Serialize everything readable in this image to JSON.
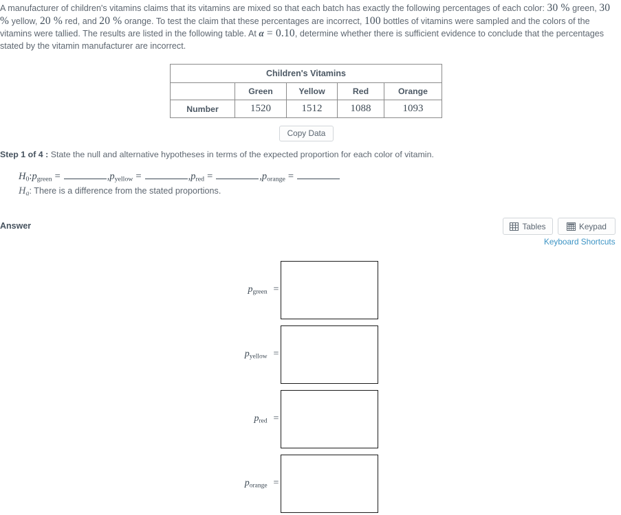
{
  "problem": {
    "part1": "A manufacturer of children's vitamins claims that its vitamins are mixed so that each batch has exactly the following percentages of each color: ",
    "pct_green": "30 %",
    "after_green": " green, ",
    "pct_yellow": "30 %",
    "after_yellow": " yellow, ",
    "pct_red": "20 %",
    "after_red": " red, and ",
    "pct_orange": "20 %",
    "after_orange": " orange. To test the claim that these percentages are incorrect, ",
    "sample_size": "100",
    "part2": " bottles of vitamins were sampled and the colors of the vitamins were tallied. The results are listed in the following table. At ",
    "alpha_symbol": "α",
    "equals": " = ",
    "alpha_value": "0.10",
    "part3": ", determine whether there is sufficient evidence to conclude that the percentages stated by the vitamin manufacturer are incorrect."
  },
  "data_table": {
    "title": "Children's Vitamins",
    "row_header_blank": "",
    "columns": [
      "Green",
      "Yellow",
      "Red",
      "Orange"
    ],
    "row_label": "Number",
    "values": [
      "1520",
      "1512",
      "1088",
      "1093"
    ]
  },
  "copy_data_button": {
    "label": "Copy Data"
  },
  "step": {
    "label": "Step 1 of 4 :",
    "text": "State the null and alternative hypotheses in terms of the expected proportion for each color of vitamin."
  },
  "hypotheses": {
    "h0_symbol": "H",
    "h0_sub": "0",
    "h0_colon": ":",
    "p_symbol": "p",
    "sub_green": "green",
    "sub_yellow": "yellow",
    "sub_red": "red",
    "sub_orange": "orange",
    "equals": "=",
    "comma": ",",
    "ha_symbol": "H",
    "ha_sub": "a",
    "ha_text": ": There is a difference from the stated proportions."
  },
  "answer_section": {
    "label": "Answer",
    "tables_button": "Tables",
    "keypad_button": "Keypad",
    "keyboard_shortcuts": "Keyboard Shortcuts",
    "tables_icon": "table-grid-icon",
    "keypad_icon": "calculator-keypad-icon"
  },
  "answer_rows": [
    {
      "label_p": "p",
      "label_sub": "green",
      "equals": "=",
      "value": ""
    },
    {
      "label_p": "p",
      "label_sub": "yellow",
      "equals": "=",
      "value": ""
    },
    {
      "label_p": "p",
      "label_sub": "red",
      "equals": "=",
      "value": ""
    },
    {
      "label_p": "p",
      "label_sub": "orange",
      "equals": "=",
      "value": ""
    }
  ],
  "colors": {
    "text": "#5d6670",
    "heading": "#46525e",
    "link": "#3b93c4",
    "table_border": "#8a8a8a",
    "input_border": "#1b1b1b",
    "button_border": "#d2d6da"
  }
}
